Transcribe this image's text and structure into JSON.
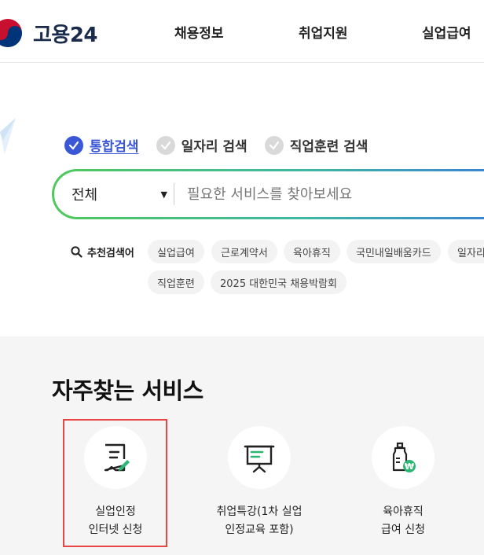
{
  "header": {
    "logo_text": "고용24",
    "nav": [
      "채용정보",
      "취업지원",
      "실업급여"
    ]
  },
  "search": {
    "tabs": [
      {
        "label": "통합검색",
        "active": true
      },
      {
        "label": "일자리 검색",
        "active": false
      },
      {
        "label": "직업훈련 검색",
        "active": false
      }
    ],
    "category": "전체",
    "placeholder": "필요한 서비스를 찾아보세요",
    "recommend_label": "추천검색어",
    "keywords": [
      "실업급여",
      "근로계약서",
      "육아휴직",
      "국민내일배움카드",
      "일자리",
      "직업훈련",
      "2025 대한민국 채용박람회"
    ]
  },
  "services": {
    "title": "자주찾는 서비스",
    "items": [
      {
        "line1": "실업인정",
        "line2": "인터넷 신청",
        "icon": "document-edit-icon"
      },
      {
        "line1": "취업특강(1차 실업",
        "line2": "인정교육 포함)",
        "icon": "presentation-board-icon"
      },
      {
        "line1": "육아휴직",
        "line2": "급여 신청",
        "icon": "baby-bottle-won-icon"
      }
    ]
  },
  "colors": {
    "accent": "#3a57d6",
    "green": "#2bb673",
    "highlight": "#e84545"
  }
}
